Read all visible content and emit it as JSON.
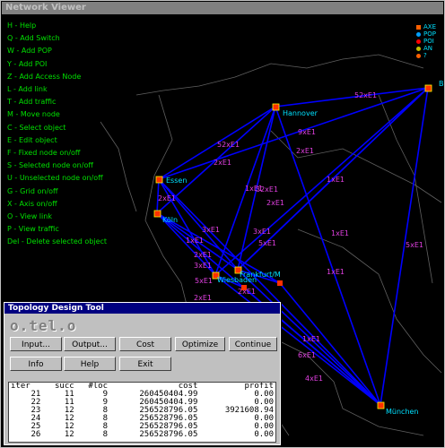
{
  "window": {
    "title": "Network Viewer"
  },
  "help_lines": [
    "H - Help",
    "Q - Add Switch",
    "W - Add POP",
    "Y - Add POI",
    "Z - Add Access Node",
    "L - Add link",
    "T - Add traffic",
    "M - Move node",
    "C - Select object",
    "E - Edit object",
    "F - Fixed node on/off",
    "S - Selected node on/off",
    "U - Unselected node on/off",
    "G - Grid on/off",
    "X - Axis on/off",
    "O - View link",
    "P - View traffic",
    "Del - Delete selected object"
  ],
  "legend": [
    "AXE",
    "POP",
    "POI",
    "AN",
    "?"
  ],
  "legend_colors": [
    "#ff6000",
    "#00a0ff",
    "#ff0000",
    "#c0c000",
    "#ff6000"
  ],
  "cities": [
    {
      "name": "Hannover"
    },
    {
      "name": "Essen"
    },
    {
      "name": "Köln"
    },
    {
      "name": "Frankfurt/M"
    },
    {
      "name": "Wiesbaden"
    },
    {
      "name": "München"
    },
    {
      "name": "B"
    }
  ],
  "link_labels": [
    "52xE1",
    "52xE1",
    "2xE1",
    "9xE1",
    "2xE1",
    "2xE1",
    "1xE1",
    "32xE1",
    "2xE1",
    "3xE1",
    "1xE1",
    "3xE1",
    "1xE1",
    "2xE1",
    "3xE1",
    "5xE1",
    "2xE1",
    "1xE1",
    "5xE1",
    "1xE1",
    "5xE1",
    "2xE1",
    "1xE1",
    "6xE1",
    "4xE1"
  ],
  "colors": {
    "link": "#0000ff",
    "node": "#ff3000",
    "link_label": "#e040e0",
    "city_label": "#00e0ff",
    "help": "#00e000"
  },
  "dialog": {
    "title": "Topology Design Tool",
    "logo": "o.tel.o",
    "buttons_row1": [
      "Input...",
      "Output...",
      "Cost",
      "Optimize",
      "Continue"
    ],
    "buttons_row2": [
      "Info",
      "Help",
      "Exit"
    ],
    "table": {
      "headers": [
        "iter",
        "succ",
        "#loc",
        "cost",
        "profit"
      ],
      "rows": [
        [
          "21",
          "11",
          "9",
          "260450404.99",
          "0.00"
        ],
        [
          "22",
          "11",
          "9",
          "260450404.99",
          "0.00"
        ],
        [
          "23",
          "12",
          "8",
          "256528796.05",
          "3921608.94"
        ],
        [
          "24",
          "12",
          "8",
          "256528796.05",
          "0.00"
        ],
        [
          "25",
          "12",
          "8",
          "256528796.05",
          "0.00"
        ],
        [
          "26",
          "12",
          "8",
          "256528796.05",
          "0.00"
        ]
      ]
    }
  }
}
